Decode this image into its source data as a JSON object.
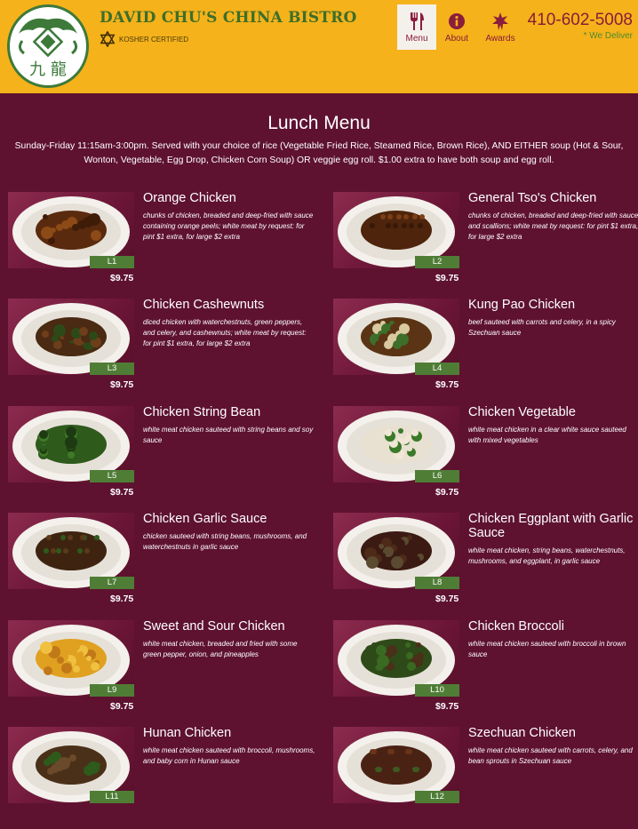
{
  "header": {
    "brand": "DAVID CHU'S CHINA BISTRO",
    "kosher": "KOSHER CERTIFIED",
    "logo_chars": "九 龍",
    "phone": "410-602-5008",
    "deliver": "* We Deliver",
    "nav": [
      {
        "label": "Menu",
        "icon": "utensils-icon"
      },
      {
        "label": "About",
        "icon": "info-icon"
      },
      {
        "label": "Awards",
        "icon": "award-icon"
      }
    ]
  },
  "menu": {
    "title": "Lunch Menu",
    "subtitle": "Sunday-Friday 11:15am-3:00pm. Served with your choice of rice (Vegetable Fried Rice, Steamed Rice, Brown Rice), AND EITHER soup (Hot & Sour, Wonton, Vegetable, Egg Drop, Chicken Corn Soup) OR veggie egg roll. $1.00 extra to have both soup and egg roll.",
    "dishes": [
      {
        "code": "L1",
        "name": "Orange Chicken",
        "desc": "chunks of chicken, breaded and deep-fried with sauce containing orange peels; white meat by request: for pint $1 extra, for large $2 extra",
        "price": "$9.75"
      },
      {
        "code": "L2",
        "name": "General Tso's Chicken",
        "desc": "chunks of chicken, breaded and deep-fried with sauce and scallions; white meat by request: for pint $1 extra, for large $2 extra",
        "price": "$9.75"
      },
      {
        "code": "L3",
        "name": "Chicken Cashewnuts",
        "desc": "diced chicken with waterchestnuts, green peppers, and celery, and cashewnuts; white meat by request: for pint $1 extra, for large $2 extra",
        "price": "$9.75"
      },
      {
        "code": "L4",
        "name": "Kung Pao Chicken",
        "desc": "beef sauteed with carrots and celery, in a spicy Szechuan sauce",
        "price": "$9.75"
      },
      {
        "code": "L5",
        "name": "Chicken String Bean",
        "desc": "white meat chicken sauteed with string beans and soy sauce",
        "price": "$9.75"
      },
      {
        "code": "L6",
        "name": "Chicken Vegetable",
        "desc": "white meat chicken in a clear white sauce sauteed with mixed vegetables",
        "price": "$9.75"
      },
      {
        "code": "L7",
        "name": "Chicken Garlic Sauce",
        "desc": "chicken sauteed with string beans, mushrooms, and waterchestnuts in garlic sauce",
        "price": "$9.75"
      },
      {
        "code": "L8",
        "name": "Chicken Eggplant with Garlic Sauce",
        "desc": "white meat chicken, string beans, waterchestnuts, mushrooms, and eggplant, in garlic sauce",
        "price": "$9.75"
      },
      {
        "code": "L9",
        "name": "Sweet and Sour Chicken",
        "desc": "white meat chicken, breaded and fried with some green pepper, onion, and pineapples",
        "price": "$9.75"
      },
      {
        "code": "L10",
        "name": "Chicken Broccoli",
        "desc": "white meat chicken sauteed with broccoli in brown sauce",
        "price": "$9.75"
      },
      {
        "code": "L11",
        "name": "Hunan Chicken",
        "desc": "white meat chicken sauteed with broccoli, mushrooms, and baby corn in Hunan sauce",
        "price": ""
      },
      {
        "code": "L12",
        "name": "Szechuan Chicken",
        "desc": "white meat chicken sauteed with carrots, celery, and bean sprouts in Szechuan sauce",
        "price": ""
      }
    ]
  },
  "colors": {
    "header_bg": "#f5b21a",
    "page_bg": "#5e1230",
    "brand_green": "#3d6e2a",
    "accent_maroon": "#8a1c3c",
    "code_badge": "#4f7d36"
  }
}
